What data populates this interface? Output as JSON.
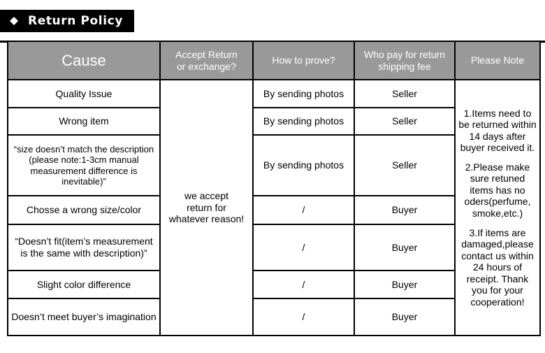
{
  "header": {
    "title": "Return Policy",
    "diamond_icon": "diamond-icon"
  },
  "table": {
    "columns": [
      "Cause",
      "Accept Return\nor exchange?",
      "How to prove?",
      "Who pay for return\nshipping fee",
      "Please Note"
    ],
    "column_headers": {
      "cause": "Cause",
      "accept_line1": "Accept Return",
      "accept_line2": "or exchange?",
      "prove": "How to prove?",
      "pay_line1": "Who pay for return",
      "pay_line2": "shipping fee",
      "note": "Please Note"
    },
    "accept_merged_cell": {
      "line1": "we accept",
      "line2": "return for",
      "line3": "whatever reason!"
    },
    "note_merged_cell": {
      "paragraph1": "1.Items need to be returned within 14 days after buyer received it.",
      "paragraph2": "2.Please make sure retuned items has no oders(perfume, smoke,etc.)",
      "paragraph3": "3.If items are damaged,please contact us within 24 hours of receipt. Thank you for your cooperation!"
    },
    "rows": [
      {
        "cause": "Quality Issue",
        "prove": "By sending photos",
        "pay": "Seller"
      },
      {
        "cause": "Wrong item",
        "prove": "By sending photos",
        "pay": "Seller"
      },
      {
        "cause": "“size doesn’t match the description (please note:1-3cm manual measurement difference is inevitable)”",
        "prove": "By sending photos",
        "pay": "Seller"
      },
      {
        "cause": "Chosse a wrong size/color",
        "prove": "/",
        "pay": "Buyer"
      },
      {
        "cause": "“Doesn’t fit(item’s measurement is the same with description)”",
        "prove": "/",
        "pay": "Buyer"
      },
      {
        "cause": "Slight color difference",
        "prove": "/",
        "pay": "Buyer"
      },
      {
        "cause": "Doesn’t meet buyer’s imagination",
        "prove": "/",
        "pay": "Buyer"
      }
    ]
  },
  "colors": {
    "header_background": "#999999",
    "header_text": "#ffffff",
    "banner_background": "#000000",
    "banner_text": "#ffffff",
    "border": "#000000",
    "page_background": "#ffffff"
  }
}
